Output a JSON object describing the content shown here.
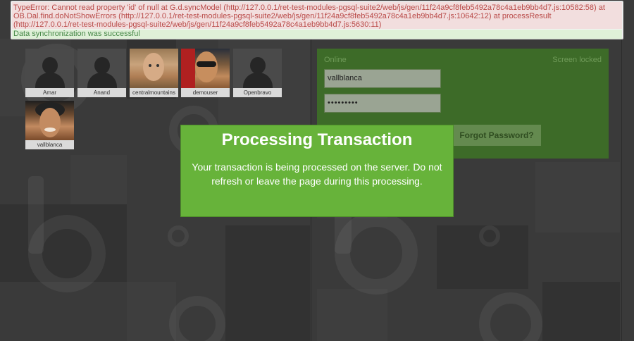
{
  "messages": {
    "error": "TypeError: Cannot read property 'id' of null at G.d.syncModel (http://127.0.0.1/ret-test-modules-pgsql-suite2/web/js/gen/11f24a9cf8feb5492a78c4a1eb9bb4d7.js:10582:58) at OB.Dal.find.doNotShowErrors (http://127.0.0.1/ret-test-modules-pgsql-suite2/web/js/gen/11f24a9cf8feb5492a78c4a1eb9bb4d7.js:10642:12) at processResult (http://127.0.0.1/ret-test-modules-pgsql-suite2/web/js/gen/11f24a9cf8feb5492a78c4a1eb9bb4d7.js:5630:11)",
    "success": "Data synchronization was successful"
  },
  "users": [
    {
      "name": "Amar",
      "avatar": "default-avatar-icon"
    },
    {
      "name": "Anand",
      "avatar": "default-avatar-icon"
    },
    {
      "name": "centralmountains",
      "avatar": "user-photo"
    },
    {
      "name": "demouser",
      "avatar": "user-photo"
    },
    {
      "name": "Openbravo",
      "avatar": "default-avatar-icon"
    },
    {
      "name": "vallblanca",
      "avatar": "user-photo"
    }
  ],
  "login": {
    "status": "Online",
    "screen_state": "Screen locked",
    "username_value": "vallblanca",
    "password_value": "•••••••••",
    "forgot_label": "Forgot Password?"
  },
  "modal": {
    "title": "Processing Transaction",
    "body": "Your transaction is being processed on the server. Do not refresh or leave the page during this processing."
  },
  "colors": {
    "background": "#3a3a3a",
    "login_panel": "#3d6b28",
    "modal": "#67b33a",
    "error_bg": "#f2dede",
    "success_bg": "#dff0d8"
  }
}
